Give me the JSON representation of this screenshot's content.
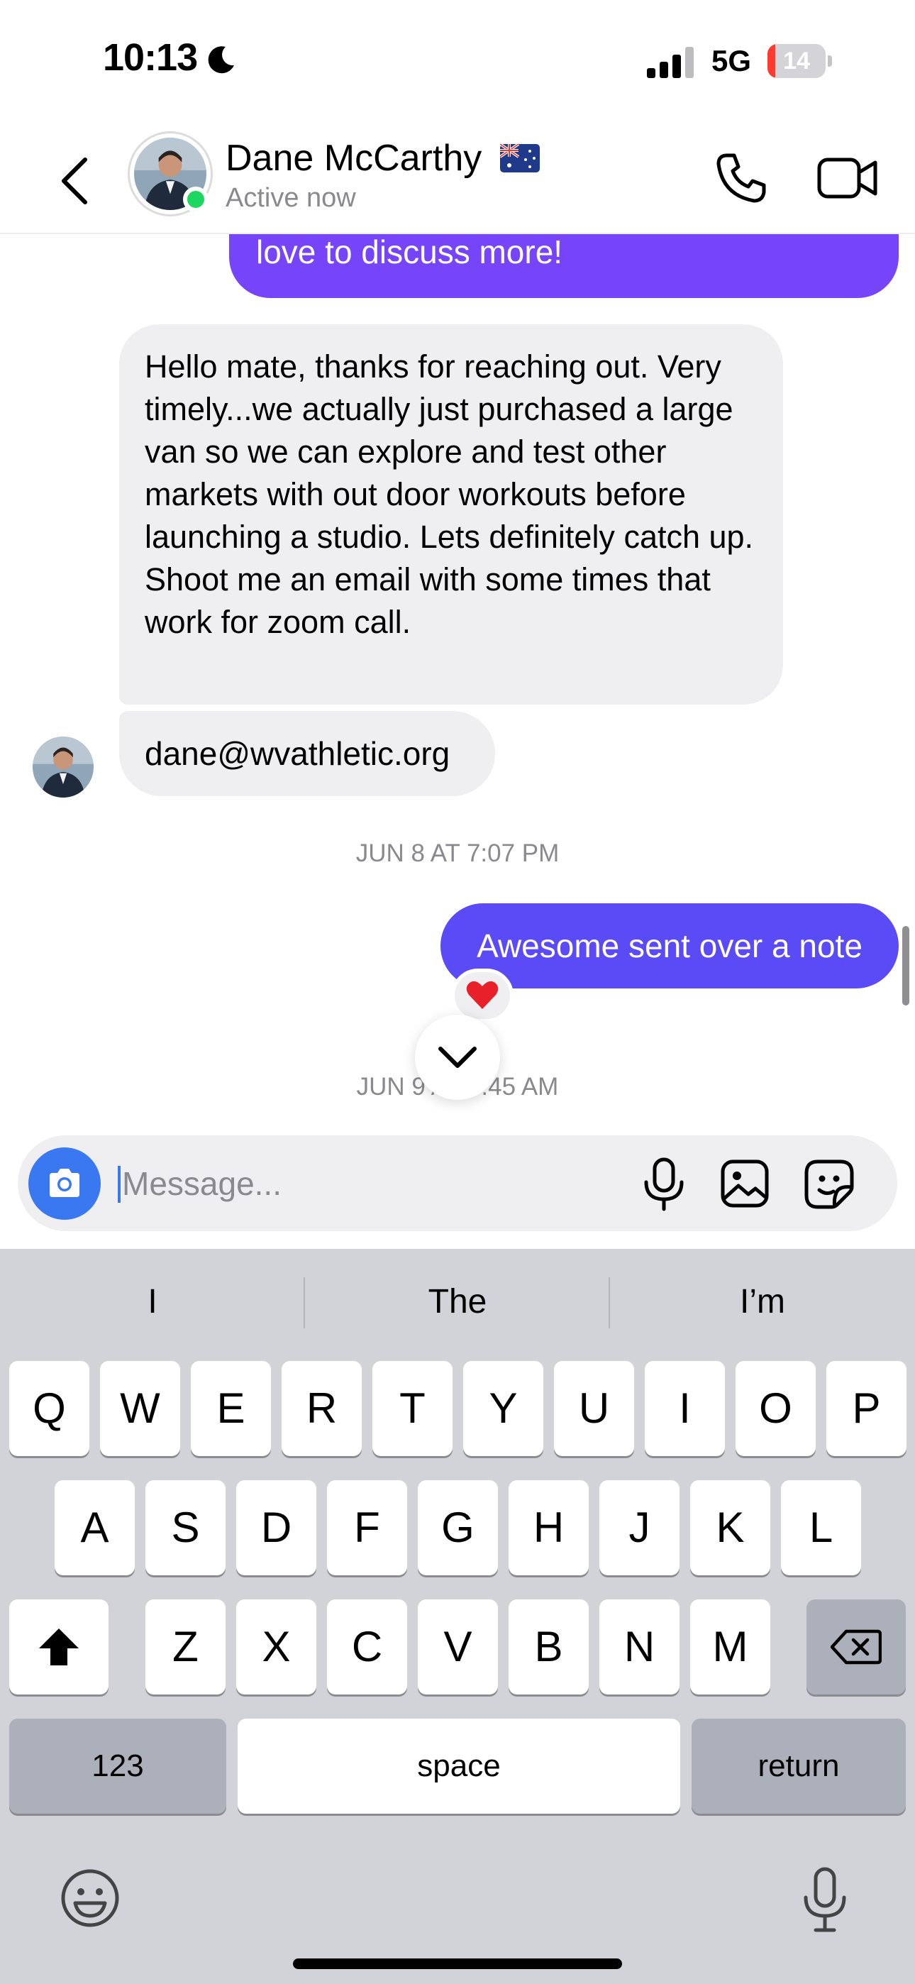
{
  "status_bar": {
    "time": "10:13",
    "network": "5G",
    "battery_level": "14",
    "battery_fraction": 0.14,
    "low_battery_color": "#ff3b30"
  },
  "header": {
    "contact_name": "Dane McCarthy",
    "contact_flag": "australia-flag-icon",
    "contact_status": "Active now",
    "online_color": "#1ed760"
  },
  "chat": {
    "messages": [
      {
        "direction": "outgoing",
        "text": "love to discuss more!",
        "color": "#7644f9"
      },
      {
        "direction": "incoming",
        "text": "Hello mate, thanks for reaching out. Very timely...we actually just purchased a large van so we can explore and test other markets with out door workouts before launching a studio. Lets definitely catch up. Shoot me an email with some times that work for zoom call."
      },
      {
        "direction": "incoming",
        "text": "dane@wvathletic.org"
      },
      {
        "direction": "outgoing",
        "text": "Awesome sent over a note",
        "color": "#5a4bf6",
        "reaction": "red-heart"
      }
    ],
    "timestamps": [
      "JUN 8 AT 7:07 PM",
      "JUN 9 AT 9:45 AM"
    ]
  },
  "composer": {
    "placeholder": "Message..."
  },
  "keyboard": {
    "predictions": [
      "I",
      "The",
      "I’m"
    ],
    "row1": [
      "Q",
      "W",
      "E",
      "R",
      "T",
      "Y",
      "U",
      "I",
      "O",
      "P"
    ],
    "row2": [
      "A",
      "S",
      "D",
      "F",
      "G",
      "H",
      "J",
      "K",
      "L"
    ],
    "row3": [
      "Z",
      "X",
      "C",
      "V",
      "B",
      "N",
      "M"
    ],
    "numbers_label": "123",
    "space_label": "space",
    "return_label": "return"
  }
}
